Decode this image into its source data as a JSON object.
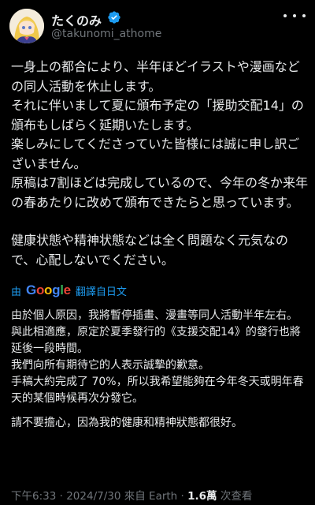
{
  "author": {
    "display_name": "たくのみ",
    "handle": "@takunomi_athome",
    "verified": true,
    "verified_color": "#1d9bf0"
  },
  "icons": {
    "more": "more-horizontal-icon",
    "verified": "verified-badge-icon"
  },
  "post": {
    "paragraph_1": "一身上の都合により、半年ほどイラストや漫画などの同人活動を休止します。\nそれに伴いまして夏に頒布予定の「援助交配14」の頒布もしばらく延期いたします。\n楽しみにしてくださっていた皆様には誠に申し訳ございません。\n原稿は7割ほどは完成しているので、今年の冬か来年の春あたりに改めて頒布できたらと思っています。",
    "paragraph_2": "健康状態や精神状態などは全く問題なく元気なので、心配しないでください。"
  },
  "translation_bar": {
    "by_label": "由",
    "provider": "Google",
    "source_label": "翻譯自日文",
    "link_color": "#1d9bf0"
  },
  "translation": {
    "paragraph_1": "由於個人原因，我將暫停插畫、漫畫等同人活動半年左右。\n與此相適應，原定於夏季發行的《支援交配14》的發行也將延後一段時間。\n我們向所有期待它的人表示誠摯的歉意。\n手稿大約完成了 70%，所以我希望能夠在今年冬天或明年春天的某個時候再次分發它。",
    "paragraph_2": "請不要擔心，因為我的健康和精神狀態都很好。"
  },
  "meta": {
    "time": "下午6:33",
    "date": "2024/7/30",
    "source": "來自 Earth",
    "views_count": "1.6萬",
    "views_label": "次查看",
    "separator": "·"
  }
}
